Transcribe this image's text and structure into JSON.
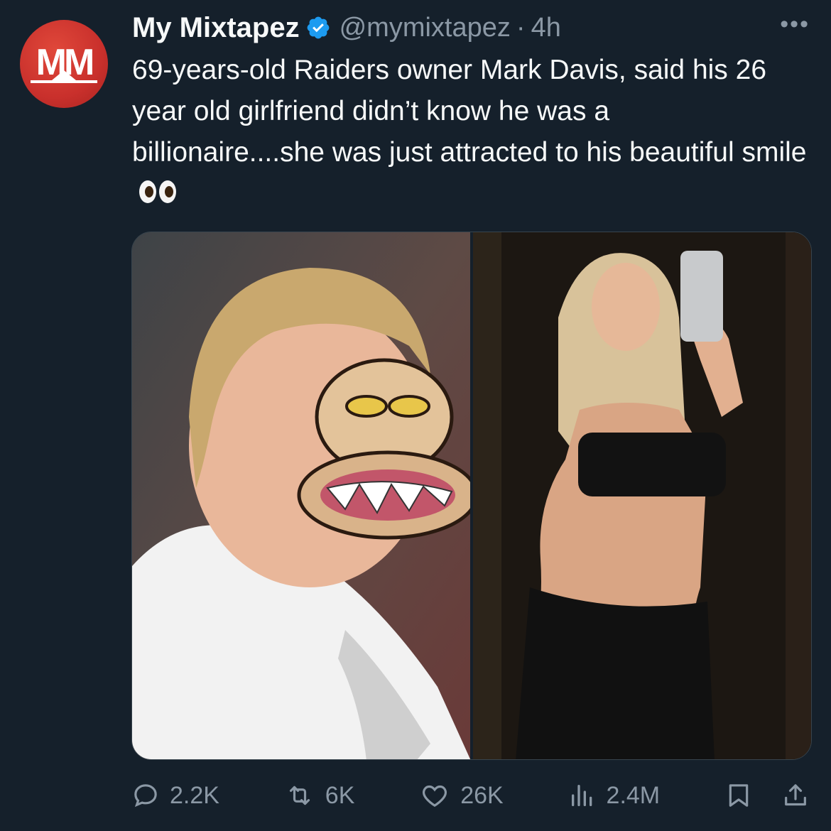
{
  "tweet": {
    "author": {
      "display_name": "My Mixtapez",
      "handle": "@mymixtapez",
      "verified": true,
      "avatar_logo_text": "MM",
      "avatar_color": "#c9302c"
    },
    "separator": "·",
    "time": "4h",
    "text": "69-years-old Raiders owner Mark Davis, said his 26 year old girlfriend didn’t know he was a billionaire....she was just attracted to his beautiful smile",
    "text_emoji": "eyes-emoji",
    "media": [
      {
        "alt_desc": "man-with-cartoon-face-overlay"
      },
      {
        "alt_desc": "woman-mirror-selfie"
      }
    ],
    "stats": {
      "replies": "2.2K",
      "reposts": "6K",
      "likes": "26K",
      "views": "2.4M"
    }
  },
  "colors": {
    "background": "#15202b",
    "text": "#f7f9f9",
    "muted": "#8b98a5",
    "verified_blue": "#1d9bf0"
  }
}
